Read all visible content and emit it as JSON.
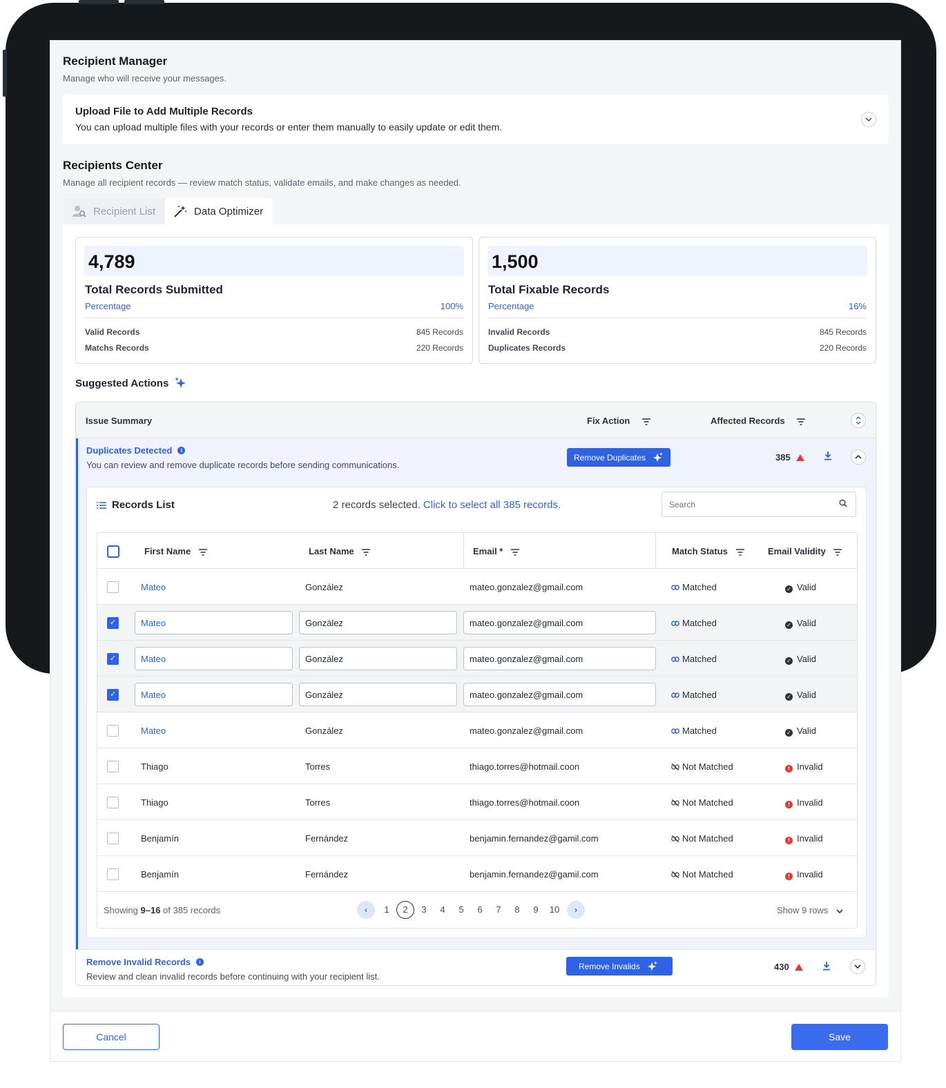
{
  "header": {
    "title": "Recipient Manager",
    "subtitle": "Manage who will receive your messages."
  },
  "upload": {
    "title": "Upload File to Add Multiple Records",
    "subtitle": "You can upload multiple files with your records or enter them manually to easily update or edit them."
  },
  "center": {
    "title": "Recipients Center",
    "subtitle": "Manage all recipient records — review match status, validate emails, and make changes as needed."
  },
  "tabs": [
    {
      "label": "Recipient List",
      "icon": "user-search-icon",
      "active": false
    },
    {
      "label": "Data Optimizer",
      "icon": "magic-wand-icon",
      "active": true
    }
  ],
  "stats": [
    {
      "value": "4,789",
      "label": "Total Records Submitted",
      "pct_label": "Percentage",
      "pct_value": "100%",
      "rows": [
        {
          "label": "Valid Records",
          "value": "845 Records"
        },
        {
          "label": "Matchs Records",
          "value": "220 Records"
        }
      ]
    },
    {
      "value": "1,500",
      "label": "Total Fixable Records",
      "pct_label": "Percentage",
      "pct_value": "16%",
      "rows": [
        {
          "label": "Invalid Records",
          "value": "845 Records"
        },
        {
          "label": "Duplicates Records",
          "value": "220 Records"
        }
      ]
    }
  ],
  "suggested": {
    "title": "Suggested Actions"
  },
  "issues_table": {
    "col_issue": "Issue Summary",
    "col_fix": "Fix Action",
    "col_affected": "Affected Records"
  },
  "duplicates": {
    "title": "Duplicates Detected",
    "subtitle": "You can review and remove duplicate records before sending communications.",
    "button": "Remove Duplicates",
    "count": "385"
  },
  "records": {
    "title": "Records List",
    "selected_text": "2 records selected.",
    "select_all_link": "Click to select all 385 records.",
    "search_placeholder": "Search",
    "columns": {
      "first": "First Name",
      "last": "Last Name",
      "email": "Email *",
      "match": "Match Status",
      "validity": "Email Validity"
    },
    "rows": [
      {
        "first": "Mateo",
        "last": "González",
        "email": "mateo.gonzalez@gmail.com",
        "match": "Matched",
        "validity": "Valid"
      },
      {
        "first": "Mateo",
        "last": "González",
        "email": "mateo.gonzalez@gmail.com",
        "match": "Matched",
        "validity": "Valid"
      },
      {
        "first": "Mateo",
        "last": "González",
        "email": "mateo.gonzalez@gmail.com",
        "match": "Matched",
        "validity": "Valid"
      },
      {
        "first": "Mateo",
        "last": "González",
        "email": "mateo.gonzalez@gmail.com",
        "match": "Matched",
        "validity": "Valid"
      },
      {
        "first": "Mateo",
        "last": "González",
        "email": "mateo.gonzalez@gmail.com",
        "match": "Matched",
        "validity": "Valid"
      },
      {
        "first": "Thiago",
        "last": "Torres",
        "email": "thiago.torres@hotmail.coon",
        "match": "Not Matched",
        "validity": "Invalid"
      },
      {
        "first": "Thiago",
        "last": "Torres",
        "email": "thiago.torres@hotmail.coon",
        "match": "Not Matched",
        "validity": "Invalid"
      },
      {
        "first": "Benjamín",
        "last": "Fernández",
        "email": "benjamin.fernandez@gamil.com",
        "match": "Not Matched",
        "validity": "Invalid"
      },
      {
        "first": "Benjamín",
        "last": "Fernández",
        "email": "benjamin.fernandez@gamil.com",
        "match": "Not Matched",
        "validity": "Invalid"
      }
    ],
    "checked_rows": [
      false,
      true,
      true,
      true,
      false,
      false,
      false,
      false,
      false
    ],
    "pagination": {
      "showing_prefix": "Showing",
      "showing_range": "9–16",
      "showing_suffix": "of 385 records",
      "pages": [
        "1",
        "2",
        "3",
        "4",
        "5",
        "6",
        "7",
        "8",
        "9",
        "10"
      ],
      "current": "2",
      "rows_label": "Show 9 rows"
    }
  },
  "invalids": {
    "title": "Remove Invalid Records",
    "subtitle": "Review and clean invalid records before continuing with your recipient list.",
    "button": "Remove Invalids",
    "count": "430"
  },
  "footer": {
    "cancel": "Cancel",
    "save": "Save"
  },
  "colors": {
    "accent": "#2f63e6",
    "danger": "#e53935",
    "device": "#15191c"
  }
}
